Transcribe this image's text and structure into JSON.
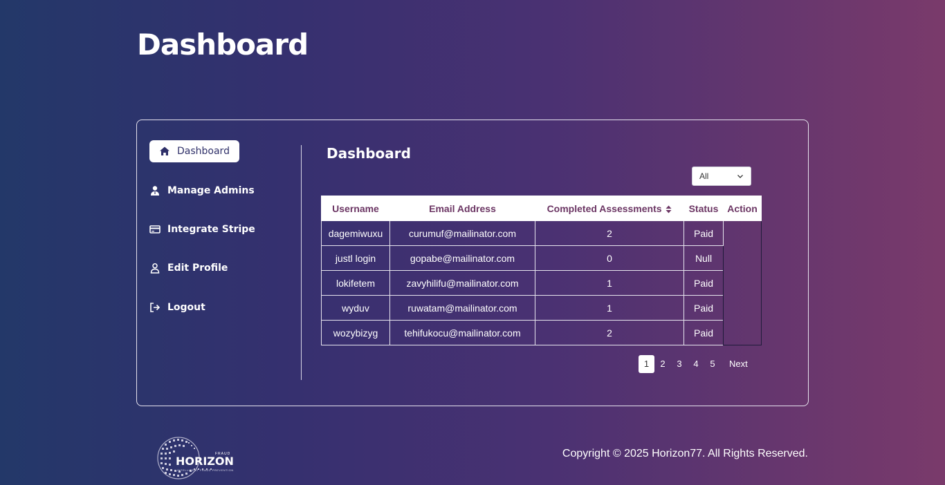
{
  "page": {
    "title": "Dashboard"
  },
  "sidebar": {
    "items": [
      {
        "label": "Dashboard",
        "icon": "home-icon",
        "active": true
      },
      {
        "label": "Manage Admins",
        "icon": "user-icon"
      },
      {
        "label": "Integrate Stripe",
        "icon": "credit-card-icon"
      },
      {
        "label": "Edit Profile",
        "icon": "user-outline-icon"
      },
      {
        "label": "Logout",
        "icon": "logout-icon"
      }
    ]
  },
  "main": {
    "title": "Dashboard",
    "filter": {
      "selected": "All"
    },
    "table": {
      "headers": [
        "Username",
        "Email Address",
        "Completed Assessments",
        "Status",
        "Action"
      ],
      "rows": [
        {
          "username": "dagemiwuxu",
          "email": "curumuf@mailinator.com",
          "completed": "2",
          "status": "Paid"
        },
        {
          "username": "justl login",
          "email": "gopabe@mailinator.com",
          "completed": "0",
          "status": "Null"
        },
        {
          "username": "lokifetem",
          "email": "zavyhilifu@mailinator.com",
          "completed": "1",
          "status": "Paid"
        },
        {
          "username": "wyduv",
          "email": "ruwatam@mailinator.com",
          "completed": "1",
          "status": "Paid"
        },
        {
          "username": "wozybizyg",
          "email": "tehifukocu@mailinator.com",
          "completed": "2",
          "status": "Paid"
        }
      ]
    },
    "pagination": {
      "pages": [
        "1",
        "2",
        "3",
        "4",
        "5"
      ],
      "current": "1",
      "next_label": "Next"
    }
  },
  "footer": {
    "logo": {
      "name": "HORIZON",
      "superscript": "FRAUD",
      "tagline": "INTELLIGENT FRAUD PREVENTION"
    },
    "copyright": "Copyright © 2025 Horizon77. All Rights Reserved."
  },
  "colors": {
    "header_text": "#6b3563",
    "active_nav_text": "#2e2f68"
  }
}
